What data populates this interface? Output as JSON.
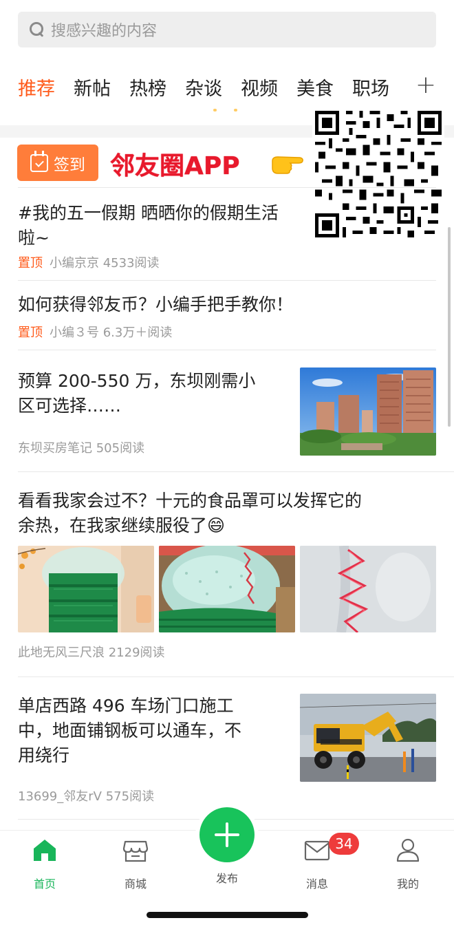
{
  "search": {
    "placeholder": "搜感兴趣的内容"
  },
  "tabs": [
    {
      "label": "推荐",
      "active": true
    },
    {
      "label": "新帖"
    },
    {
      "label": "热榜"
    },
    {
      "label": "杂谈"
    },
    {
      "label": "视频"
    },
    {
      "label": "美食"
    },
    {
      "label": "职场"
    }
  ],
  "tabs_more": "+",
  "signin": {
    "label": "签到"
  },
  "promo": {
    "text": "邻友圈APP",
    "hand_icon": "pointing-hand-icon"
  },
  "posts": [
    {
      "title_line1": "#我的五一假期 晒晒你的假期生活",
      "title_line2": "啦~",
      "pinned": "置顶",
      "author": "小编京京",
      "reads": "4533阅读"
    },
    {
      "title": "如何获得邻友币？小编手把手教你！",
      "pinned": "置顶",
      "author": "小编３号",
      "reads": "6.3万＋阅读"
    },
    {
      "title_line1": "预算 200-550 万，东坝刚需小",
      "title_line2": "区可选择……",
      "author": "东坝买房笔记",
      "reads": "505阅读"
    },
    {
      "title_line1": "看看我家会过不？十元的食品罩可以发挥它的",
      "title_line2": "余热，在我家继续服役了😄",
      "author": "此地无风三尺浪",
      "reads": "2129阅读"
    },
    {
      "title_line1": "单店西路 496 车场门口施工",
      "title_line2": "中，地面铺钢板可以通车，不",
      "title_line3": "用绕行",
      "author": "13699_邻友rV",
      "reads": "575阅读"
    }
  ],
  "bottom_nav": {
    "home": "首页",
    "mall": "商城",
    "publish": "发布",
    "messages": "消息",
    "messages_badge": "34",
    "mine": "我的"
  },
  "colors": {
    "accent": "#ff5a1a",
    "green": "#18c35b",
    "signin": "#ff7d3a",
    "promo_red": "#e8192c",
    "badge": "#ee3b3b"
  }
}
